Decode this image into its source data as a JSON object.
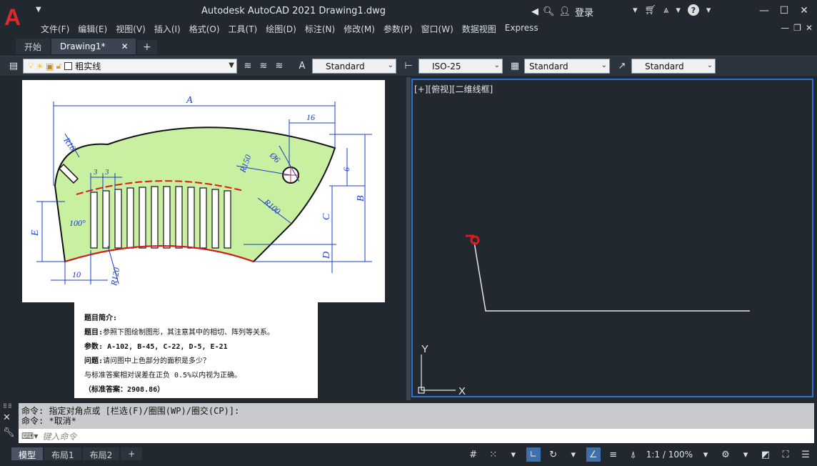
{
  "app": {
    "logo_letter": "A",
    "title": "Autodesk AutoCAD 2021    Drawing1.dwg",
    "login_label": "登录"
  },
  "menu": [
    "文件(F)",
    "编辑(E)",
    "视图(V)",
    "插入(I)",
    "格式(O)",
    "工具(T)",
    "绘图(D)",
    "标注(N)",
    "修改(M)",
    "参数(P)",
    "窗口(W)",
    "数据视图",
    "Express"
  ],
  "tabs": [
    {
      "label": "开始"
    },
    {
      "label": "Drawing1*",
      "active": true
    }
  ],
  "toolbar": {
    "layer_name": "粗实线",
    "text_style": "Standard",
    "dim_style": "ISO-25",
    "table_style": "Standard",
    "mleader_style": "Standard"
  },
  "drawing": {
    "dims": {
      "A": "A",
      "B": "B",
      "C": "C",
      "D": "D",
      "E": "E",
      "r16": "R16",
      "r150": "R150",
      "r100": "R100",
      "r120": "R120",
      "d6": "Ø6",
      "v16": "16",
      "v6": "6",
      "v3a": "3",
      "v3b": "3",
      "v10": "10",
      "a100": "100°"
    },
    "fill_color": "#c8f0a0",
    "dim_color": "#1a3cc8",
    "arc_color": "#e01818"
  },
  "problem": {
    "heading": "题目简介:",
    "line1_label": "题目:",
    "line1_text": "参照下图绘制图形，其注意其中的相切、阵列等关系。",
    "line2_label": "参数:",
    "line2_text": "A-102, B-45, C-22, D-5, E-21",
    "line3_label": "问题:",
    "line3_text": "请问图中上色部分的面积是多少？",
    "line4_text": "与标准答案相对误差在正负 0.5%以内视为正确。",
    "line5_text": "（标准答案：2908.86）"
  },
  "viewport": {
    "label": "[+][俯视][二维线框]",
    "axis_x": "X",
    "axis_y": "Y",
    "border_color": "#2f6fd0"
  },
  "command": {
    "line1": "命令: 指定对角点或 [栏选(F)/圈围(WP)/圈交(CP)]:",
    "line2": "命令: *取消*",
    "placeholder": "键入命令"
  },
  "layouts": [
    {
      "label": "模型",
      "active": true
    },
    {
      "label": "布局1"
    },
    {
      "label": "布局2"
    }
  ],
  "status": {
    "scale": "1:1 / 100%"
  }
}
